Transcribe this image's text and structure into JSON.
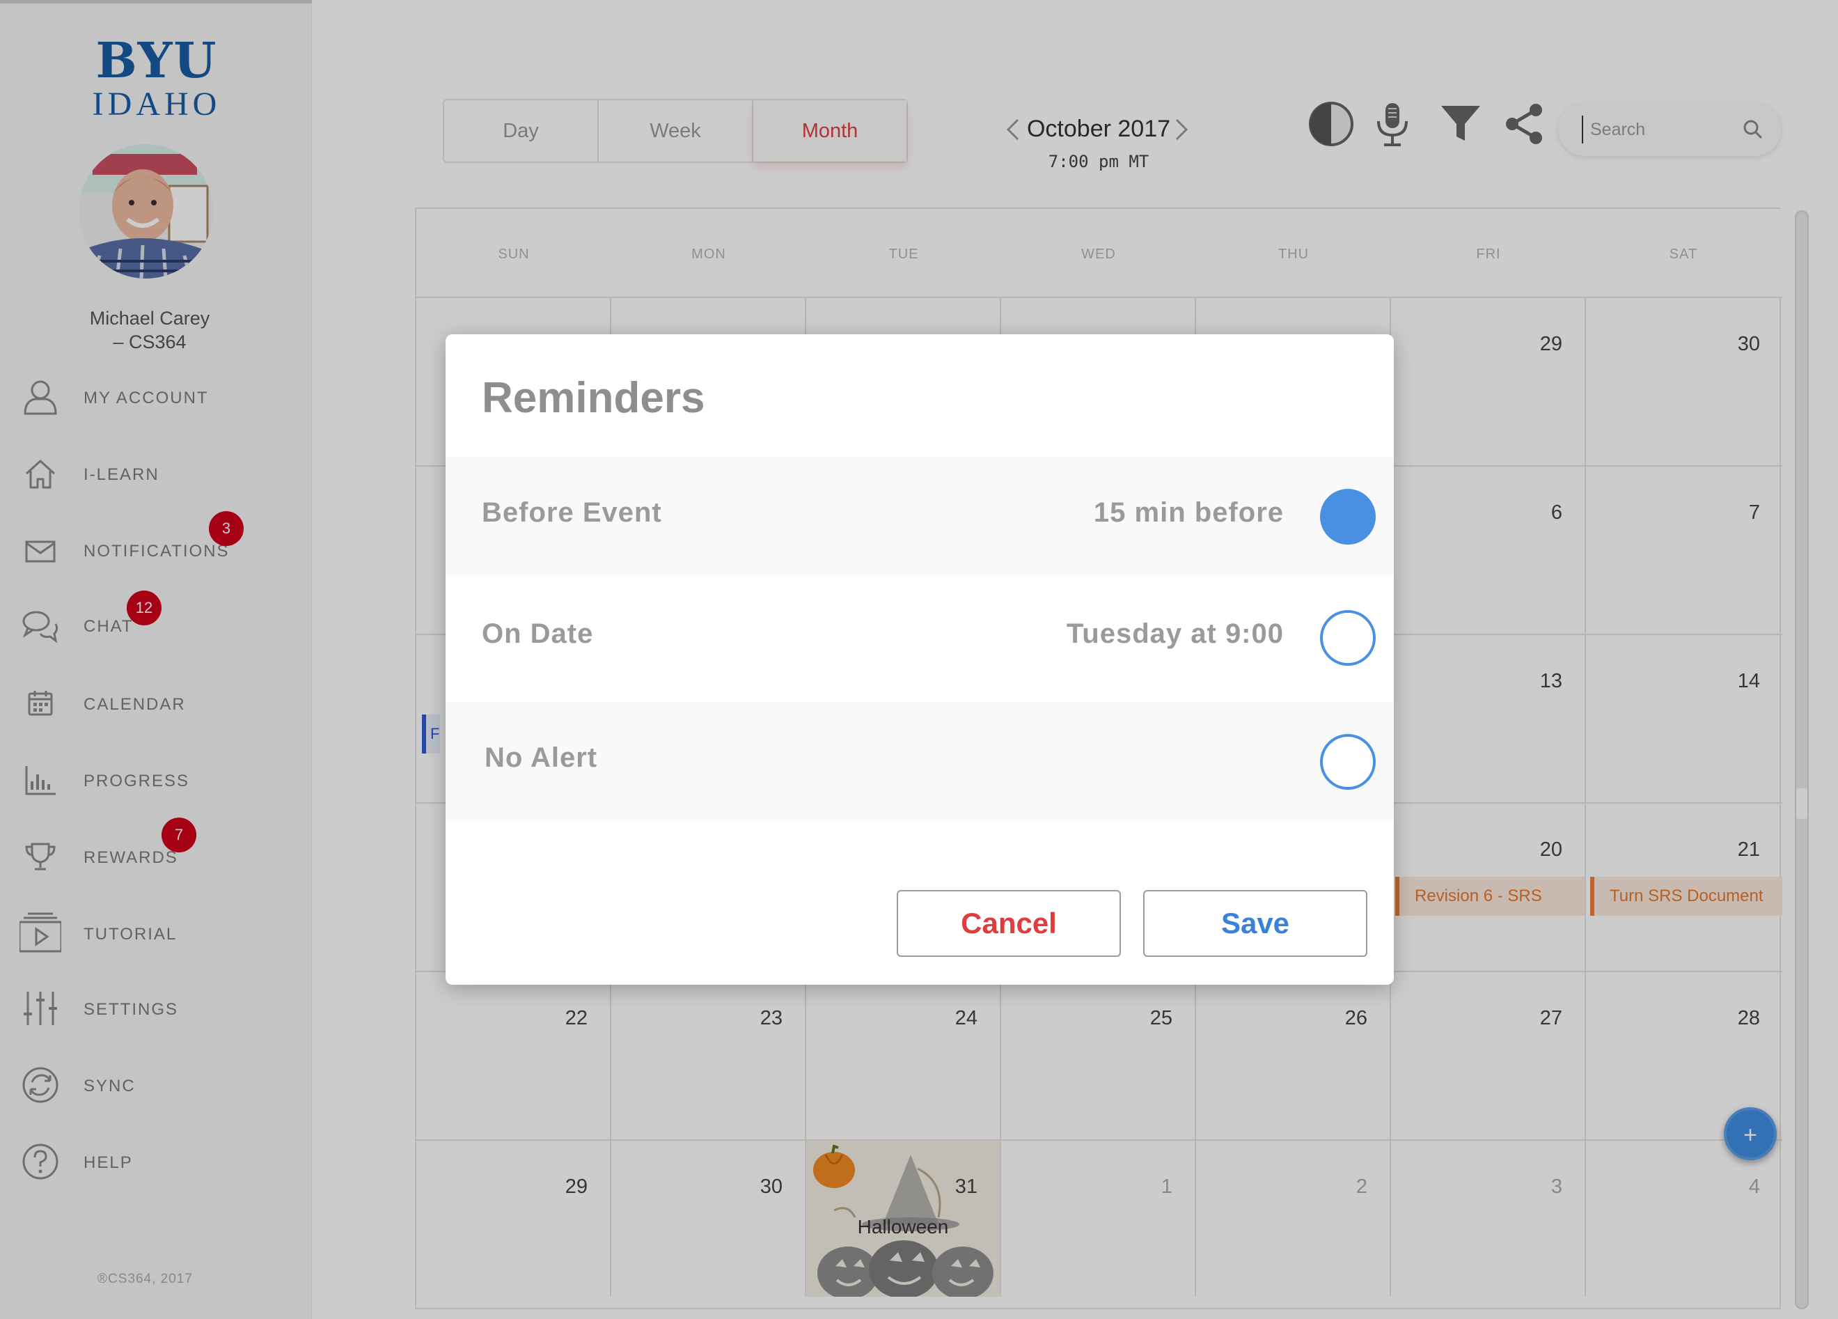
{
  "brand": {
    "line1": "BYU",
    "line2": "IDAHO",
    "primary_color": "#1a5da6"
  },
  "user": {
    "name_line1": "Michael Carey",
    "name_line2": "– CS364"
  },
  "nav": [
    {
      "label": "MY ACCOUNT",
      "icon": "user-icon"
    },
    {
      "label": "I-LEARN",
      "icon": "home-icon"
    },
    {
      "label": "NOTIFICATIONS",
      "icon": "envelope-icon",
      "badge": "3"
    },
    {
      "label": "CHAT",
      "icon": "chat-bubbles-icon",
      "badge": "12"
    },
    {
      "label": "CALENDAR",
      "icon": "calendar-icon"
    },
    {
      "label": "PROGRESS",
      "icon": "bar-chart-icon"
    },
    {
      "label": "REWARDS",
      "icon": "trophy-icon",
      "badge": "7"
    },
    {
      "label": "TUTORIAL",
      "icon": "play-video-icon"
    },
    {
      "label": "SETTINGS",
      "icon": "sliders-icon"
    },
    {
      "label": "SYNC",
      "icon": "sync-icon"
    },
    {
      "label": "HELP",
      "icon": "help-icon"
    }
  ],
  "copyright": "®CS364, 2017",
  "views": {
    "day": "Day",
    "week": "Week",
    "month": "Month",
    "active": "Month"
  },
  "header": {
    "month": "October 2017",
    "time": "7:00 pm MT"
  },
  "toolbar": {
    "icons": [
      "contrast-icon",
      "microphone-icon",
      "filter-icon",
      "share-icon"
    ]
  },
  "search": {
    "placeholder": "Search",
    "value": ""
  },
  "calendar": {
    "weekdays": [
      "SUN",
      "MON",
      "TUE",
      "WED",
      "THU",
      "FRI",
      "SAT"
    ],
    "visible_days": [
      {
        "row": 0,
        "col": 5,
        "num": "29"
      },
      {
        "row": 0,
        "col": 6,
        "num": "30"
      },
      {
        "row": 1,
        "col": 5,
        "num": "6"
      },
      {
        "row": 1,
        "col": 6,
        "num": "7"
      },
      {
        "row": 2,
        "col": 5,
        "num": "13"
      },
      {
        "row": 2,
        "col": 6,
        "num": "14"
      },
      {
        "row": 3,
        "col": 5,
        "num": "20"
      },
      {
        "row": 3,
        "col": 6,
        "num": "21"
      },
      {
        "row": 4,
        "col": 0,
        "num": "22"
      },
      {
        "row": 4,
        "col": 1,
        "num": "23"
      },
      {
        "row": 4,
        "col": 2,
        "num": "24"
      },
      {
        "row": 4,
        "col": 3,
        "num": "25"
      },
      {
        "row": 4,
        "col": 4,
        "num": "26"
      },
      {
        "row": 4,
        "col": 5,
        "num": "27"
      },
      {
        "row": 4,
        "col": 6,
        "num": "28"
      },
      {
        "row": 5,
        "col": 0,
        "num": "29"
      },
      {
        "row": 5,
        "col": 1,
        "num": "30"
      },
      {
        "row": 5,
        "col": 2,
        "num": "31"
      },
      {
        "row": 5,
        "col": 3,
        "num": "1",
        "muted": true
      },
      {
        "row": 5,
        "col": 4,
        "num": "2",
        "muted": true
      },
      {
        "row": 5,
        "col": 5,
        "num": "3",
        "muted": true
      },
      {
        "row": 5,
        "col": 6,
        "num": "4",
        "muted": true
      }
    ],
    "events": [
      {
        "row": 3,
        "col": 5,
        "label": "Revision 6 - SRS",
        "color": "#ef7e36"
      },
      {
        "row": 3,
        "col": 6,
        "label": "Turn SRS Document",
        "color": "#ef7e36"
      }
    ],
    "left_event_glyph": "F",
    "holiday": {
      "label": "Halloween"
    }
  },
  "dialog": {
    "title": "Reminders",
    "options": [
      {
        "label": "Before Event",
        "value": "15 min before",
        "checked": true
      },
      {
        "label": "On Date",
        "value": "Tuesday at 9:00",
        "checked": false
      },
      {
        "label": "No Alert",
        "value": "",
        "checked": false
      }
    ],
    "cancel_label": "Cancel",
    "save_label": "Save",
    "accent_color": "#4a90e2",
    "cancel_color": "#e03c3c"
  },
  "fab": {
    "label": "+"
  }
}
